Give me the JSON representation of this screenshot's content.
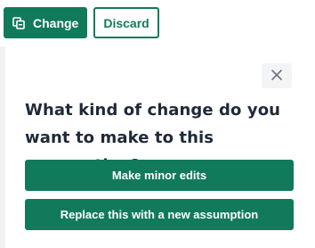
{
  "toolbar": {
    "change_label": "Change",
    "discard_label": "Discard"
  },
  "dialog": {
    "question": "What kind of change do you want to make to this assumption?",
    "options": [
      {
        "label": "Make minor edits"
      },
      {
        "label": "Replace this with a new assumption"
      }
    ]
  },
  "colors": {
    "accent": "#117a5a",
    "text": "#1f2a37",
    "close_bg": "#f3f4f6"
  },
  "icons": {
    "change": "copy-edit-icon",
    "close": "close-icon"
  }
}
